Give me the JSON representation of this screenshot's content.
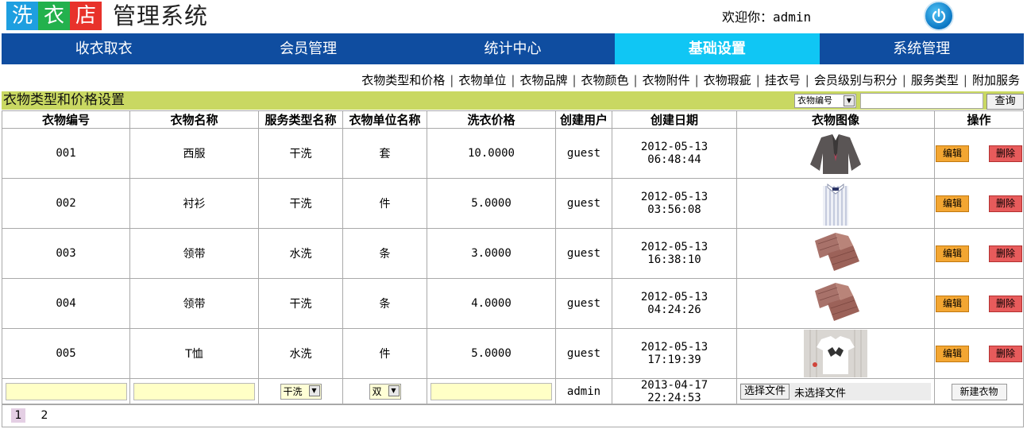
{
  "header": {
    "logo_chars": [
      "洗",
      "衣",
      "店"
    ],
    "logo_colors": [
      "#1e9fe0",
      "#23b14d",
      "#e8322b"
    ],
    "title": "管理系统",
    "welcome": "欢迎你：admin",
    "power_icon": "power-icon"
  },
  "nav": {
    "items": [
      "收衣取衣",
      "会员管理",
      "统计中心",
      "基础设置",
      "系统管理"
    ],
    "active": "基础设置",
    "active_color": "#10c6f4",
    "bar_color": "#0f4da0"
  },
  "subnav": {
    "items": [
      "衣物类型和价格",
      "衣物单位",
      "衣物品牌",
      "衣物颜色",
      "衣物附件",
      "衣物瑕疵",
      "挂衣号",
      "会员级别与积分",
      "服务类型",
      "附加服务"
    ]
  },
  "section": {
    "title": "衣物类型和价格设置",
    "filter_selected": "衣物编号",
    "search_value": "",
    "query_label": "查询",
    "bar_color": "#c9d862"
  },
  "table": {
    "headers": [
      "衣物编号",
      "衣物名称",
      "服务类型名称",
      "衣物单位名称",
      "洗衣价格",
      "创建用户",
      "创建日期",
      "衣物图像",
      "操作"
    ],
    "rows": [
      {
        "code": "001",
        "name": "西服",
        "service": "干洗",
        "unit": "套",
        "price": "10.0000",
        "user": "guest",
        "date": "2012-05-13 06:48:44",
        "image": "suit-image",
        "edit": "编辑",
        "delete": "删除"
      },
      {
        "code": "002",
        "name": "衬衫",
        "service": "干洗",
        "unit": "件",
        "price": "5.0000",
        "user": "guest",
        "date": "2012-05-13 03:56:08",
        "image": "shirt-image",
        "edit": "编辑",
        "delete": "删除"
      },
      {
        "code": "003",
        "name": "领带",
        "service": "水洗",
        "unit": "条",
        "price": "3.0000",
        "user": "guest",
        "date": "2012-05-13 16:38:10",
        "image": "tie-image",
        "edit": "编辑",
        "delete": "删除"
      },
      {
        "code": "004",
        "name": "领带",
        "service": "干洗",
        "unit": "条",
        "price": "4.0000",
        "user": "guest",
        "date": "2012-05-13 04:24:26",
        "image": "tie-image",
        "edit": "编辑",
        "delete": "删除"
      },
      {
        "code": "005",
        "name": "T恤",
        "service": "水洗",
        "unit": "件",
        "price": "5.0000",
        "user": "guest",
        "date": "2012-05-13 17:19:39",
        "image": "tshirt-image",
        "edit": "编辑",
        "delete": "删除"
      }
    ],
    "new_row": {
      "code": "",
      "name": "",
      "service_selected": "干洗",
      "unit_selected": "双",
      "price": "",
      "user": "admin",
      "date": "2013-04-17 22:24:53",
      "file_button": "选择文件",
      "file_status": "未选择文件",
      "new_button": "新建衣物"
    }
  },
  "pager": {
    "pages": [
      "1",
      "2"
    ],
    "current": "1"
  }
}
